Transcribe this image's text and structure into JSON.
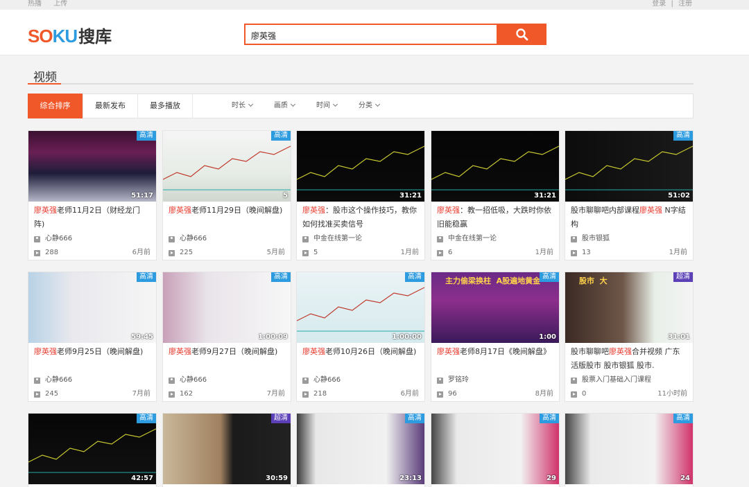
{
  "topbar": {
    "left": [
      "热播",
      "上传"
    ],
    "right": [
      "登录",
      "|",
      "注册"
    ]
  },
  "logo": {
    "so": "SO",
    "ku": "KU",
    "cn": "搜库"
  },
  "search": {
    "value": "廖英强",
    "icon": "search-icon"
  },
  "section": {
    "title": "视频"
  },
  "sorts": [
    {
      "label": "综合排序",
      "active": true
    },
    {
      "label": "最新发布",
      "active": false
    },
    {
      "label": "最多播放",
      "active": false
    }
  ],
  "filters": [
    "时长",
    "画质",
    "时间",
    "分类"
  ],
  "colors": {
    "accent": "#f0582a",
    "brand_blue": "#2d9be0",
    "highlight": "#e8382c",
    "badge_hd": "#2d9be0",
    "badge_super": "#5b3fb7"
  },
  "videos": [
    {
      "badge": "高清",
      "duration": "51:17",
      "hl": "廖英强",
      "title_rest": "老师11月2日（财经龙门阵)",
      "author": "心静666",
      "views": "288",
      "time": "6月前"
    },
    {
      "badge": "高清",
      "duration": "5",
      "hl": "廖英强",
      "title_rest": "老师11月29日（晚间解盘)",
      "author": "心静666",
      "views": "225",
      "time": "5月前"
    },
    {
      "badge": "",
      "duration": "31:21",
      "hl": "廖英强",
      "title_rest": "：股市这个操作技巧，教你如何找准买卖信号",
      "author": "中金在线第一论",
      "views": "5",
      "time": "1月前"
    },
    {
      "badge": "",
      "duration": "31:21",
      "hl": "廖英强",
      "title_rest": "：教一招低吸，大跌时你依旧能稳赢",
      "author": "中金在线第一论",
      "views": "6",
      "time": "1月前"
    },
    {
      "badge": "高清",
      "duration": "51:02",
      "pre": "股市聊聊吧内部课程",
      "hl": "廖英强",
      "title_rest": " N字结构",
      "author": "股市银狐",
      "views": "13",
      "time": "1月前"
    },
    {
      "badge": "高清",
      "duration": "59:45",
      "hl": "廖英强",
      "title_rest": "老师9月25日（晚间解盘)",
      "author": "心静666",
      "views": "245",
      "time": "7月前"
    },
    {
      "badge": "高清",
      "duration": "1:00:09",
      "hl": "廖英强",
      "title_rest": "老师9月27日（晚间解盘)",
      "author": "心静666",
      "views": "162",
      "time": "7月前"
    },
    {
      "badge": "高清",
      "duration": "1:00:00",
      "hl": "廖英强",
      "title_rest": "老师10月26日（晚间解盘)",
      "author": "心静666",
      "views": "218",
      "time": "6月前"
    },
    {
      "badge": "高清",
      "duration": "1:00",
      "hl": "廖英强",
      "title_rest": "老师8月17日《晚间解盘》",
      "author": "罗铭玲",
      "views": "96",
      "time": "8月前",
      "thumb_text": [
        "主力偷梁换柱",
        "A股遍地黄金"
      ]
    },
    {
      "badge": "超清",
      "duration": "31:01",
      "pre": "股市聊聊吧",
      "hl": "廖英强",
      "title_rest": "合并视频 广东活版股市 股市银狐 股市.",
      "author": "股票入门基础入门课程",
      "views": "0",
      "time": "11小时前",
      "thumb_text": [
        "股市",
        "大"
      ]
    },
    {
      "badge": "高清",
      "duration": "42:57"
    },
    {
      "badge": "超清",
      "duration": "30:59"
    },
    {
      "badge": "高清",
      "duration": "23:13"
    },
    {
      "badge": "高清",
      "duration": "29"
    },
    {
      "badge": "高清",
      "duration": "24"
    }
  ]
}
